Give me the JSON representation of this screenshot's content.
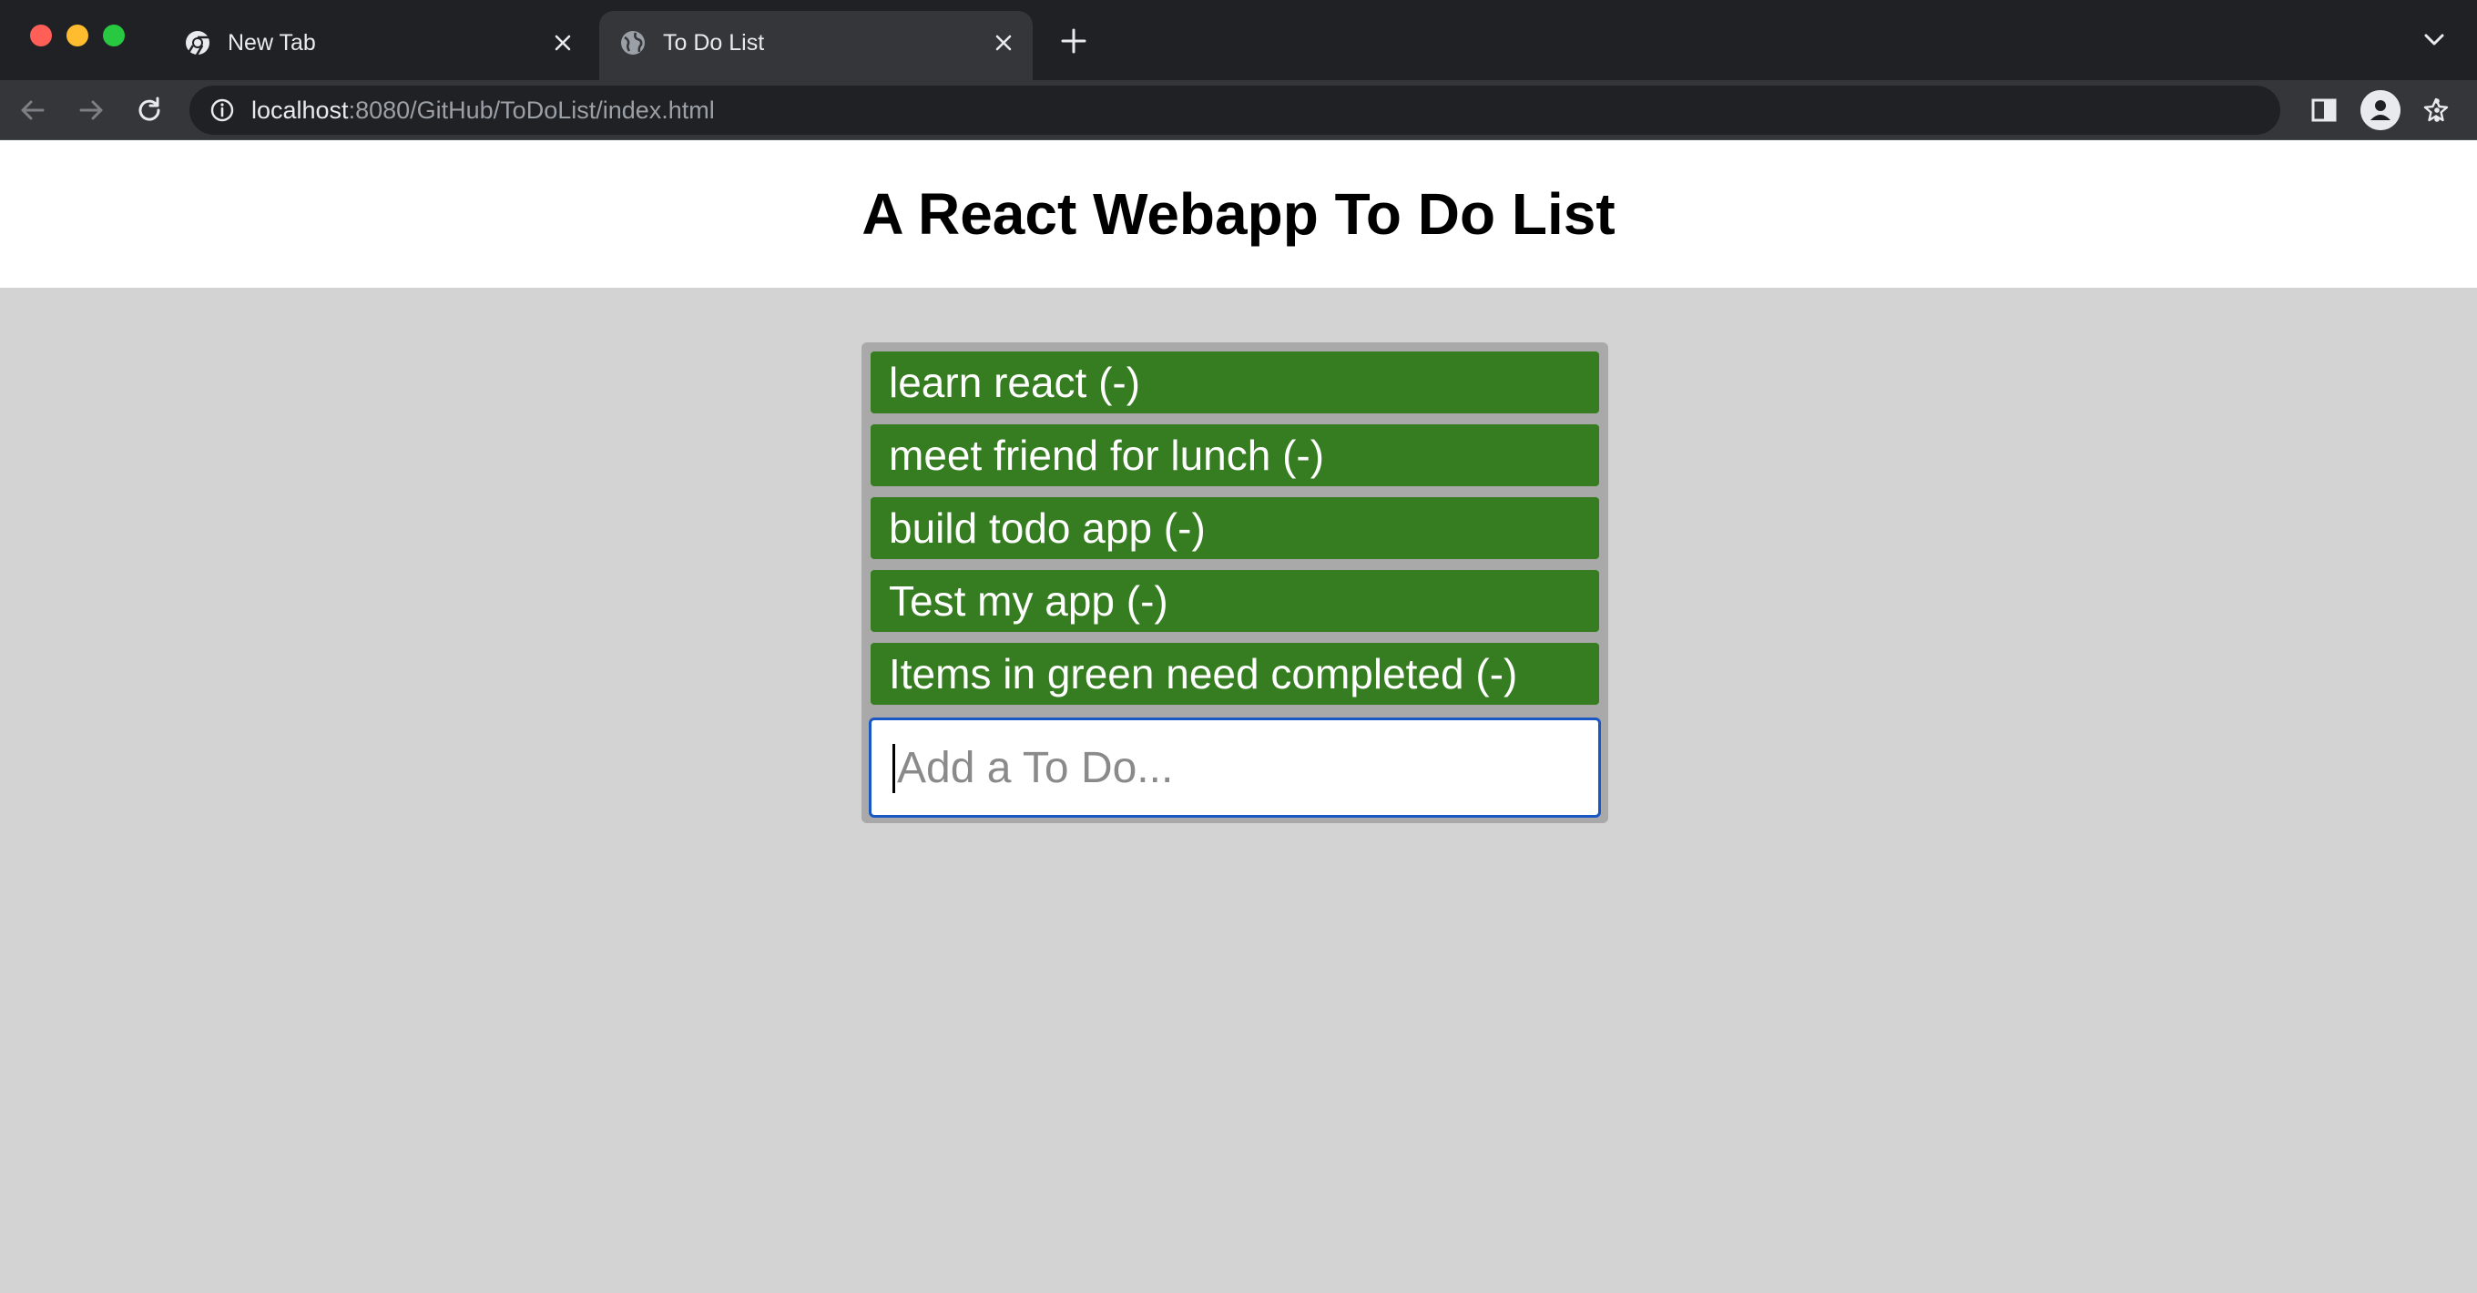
{
  "browser": {
    "tabs": [
      {
        "title": "New Tab",
        "icon": "chrome-icon",
        "active": false
      },
      {
        "title": "To Do List",
        "icon": "globe-icon",
        "active": true
      }
    ],
    "url_host": "localhost",
    "url_rest": ":8080/GitHub/ToDoList/index.html"
  },
  "page": {
    "title": "A React Webapp To Do List",
    "todos": [
      {
        "label": "learn react (-)"
      },
      {
        "label": "meet friend for lunch (-)"
      },
      {
        "label": "build todo app (-)"
      },
      {
        "label": "Test my app (-)"
      },
      {
        "label": "Items in green need completed (-)"
      }
    ],
    "input": {
      "value": "",
      "placeholder": "Add a To Do..."
    }
  },
  "colors": {
    "todo_item": "#367c21",
    "container": "#a9a9a9",
    "page_background": "#d3d3d3",
    "input_border": "#1a56c4"
  }
}
